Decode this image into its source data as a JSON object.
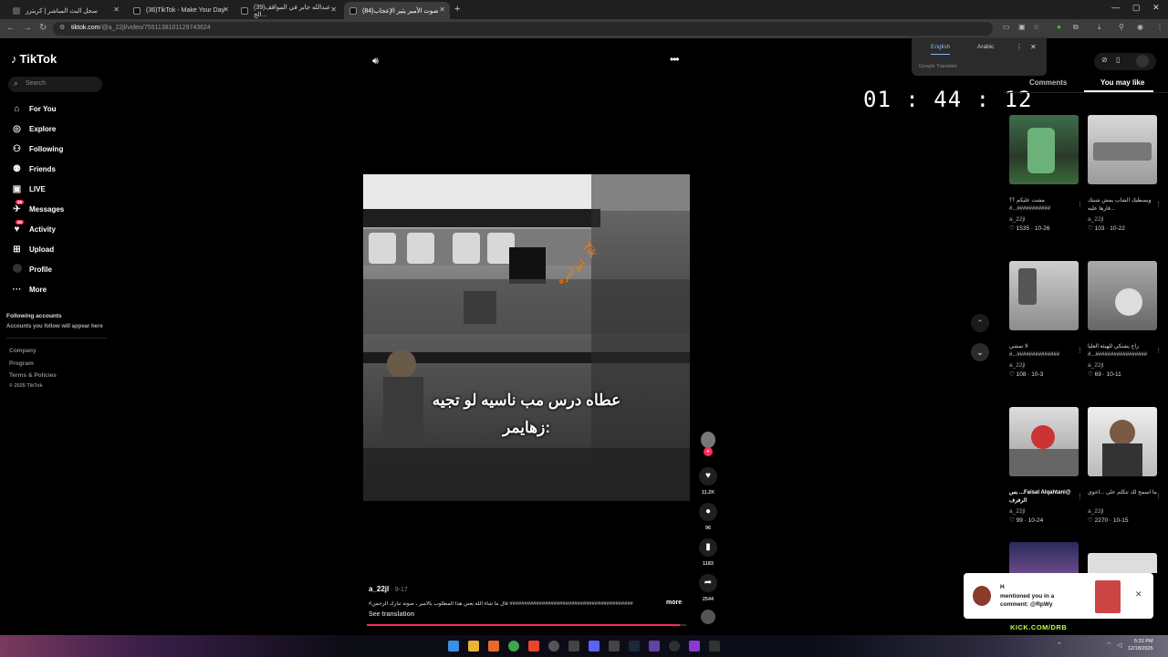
{
  "browser": {
    "tabs": [
      {
        "label": "سجل البث المباشر | كريترز"
      },
      {
        "label": "(36)TikTok - Make Your Day"
      },
      {
        "label": "(39)عبدالله جابر في المواقف الج..."
      },
      {
        "label": "(84)صوت الأمير يثير الإعجاب"
      }
    ],
    "new_tab": "+",
    "url_host": "tiktok.com",
    "url_path": "/@a_22jl/video/7551138101129743624"
  },
  "translate": {
    "lang_english": "English",
    "lang_arabic": "Arabic",
    "provider": "Google Translate"
  },
  "sidebar": {
    "brand": "TikTok",
    "search_placeholder": "Search",
    "items": [
      {
        "label": "For You",
        "icon": "home-icon"
      },
      {
        "label": "Explore",
        "icon": "compass-icon"
      },
      {
        "label": "Following",
        "icon": "following-icon"
      },
      {
        "label": "Friends",
        "icon": "friends-icon"
      },
      {
        "label": "LIVE",
        "icon": "live-icon"
      },
      {
        "label": "Messages",
        "icon": "messages-icon",
        "badge": "36"
      },
      {
        "label": "Activity",
        "icon": "activity-icon",
        "badge": "49"
      },
      {
        "label": "Upload",
        "icon": "upload-icon"
      },
      {
        "label": "Profile",
        "icon": "avatar"
      },
      {
        "label": "More",
        "icon": "more-icon"
      }
    ],
    "following_title": "Following accounts",
    "following_sub": "Accounts you follow will appear here",
    "footer": [
      "Company",
      "Program",
      "Terms & Policies",
      "© 2025 TikTok"
    ]
  },
  "video": {
    "timer": "01 : 44 : 12",
    "caption_line1": "عطاه درس مب ناسيه لو تجيه",
    "caption_line2": "زهايمر:",
    "overlay_text": "Tik",
    "overlay_text2": "ابو امره",
    "author": "a_22jl",
    "date": "9-17",
    "description": "#قال ما شاء الله يعني هذا المطلوب يالأمير ، صوته تبارك الرحمن ##########################################",
    "more": "more",
    "see_translation": "See translation",
    "progress": 0.98
  },
  "actions": {
    "likes": "11.2K",
    "comments": "96",
    "saves": "1183",
    "shares": "2544"
  },
  "right_panel": {
    "tab_comments": "Comments",
    "tab_you_may_like": "You may like",
    "cards": [
      {
        "title": "مشت عليكم ؟؟ ###########...#",
        "user": "a_22jl",
        "likes": "1535",
        "date": "10-26"
      },
      {
        "title": "ويسطيك الشاب يمش شنيك ...فارها عليه",
        "user": "a_22jl",
        "likes": "103",
        "date": "10-22"
      },
      {
        "title": "لا تمشي ##############...#",
        "user": "a_22jl",
        "likes": "108",
        "date": "10-3"
      },
      {
        "title": "راح يشتكي للهيئة العليا #################...#",
        "user": "a_22jl",
        "likes": "69",
        "date": "10-11"
      },
      {
        "title": "@Faisal Alqahtani... بس الرفرف",
        "user": "a_22jl",
        "likes": "99",
        "date": "10-24"
      },
      {
        "title": "ما اسمح لك تتكلم على ...اخوي",
        "user": "a_22jl",
        "likes": "2270",
        "date": "10-15"
      }
    ]
  },
  "notification": {
    "line1": "H",
    "line2": "mentioned you in a",
    "line3": "comment: @RpWy"
  },
  "kick_label": "KICK.COM/DRB",
  "taskbar": {
    "time": "5:31 PM",
    "date": "12/18/2025"
  }
}
